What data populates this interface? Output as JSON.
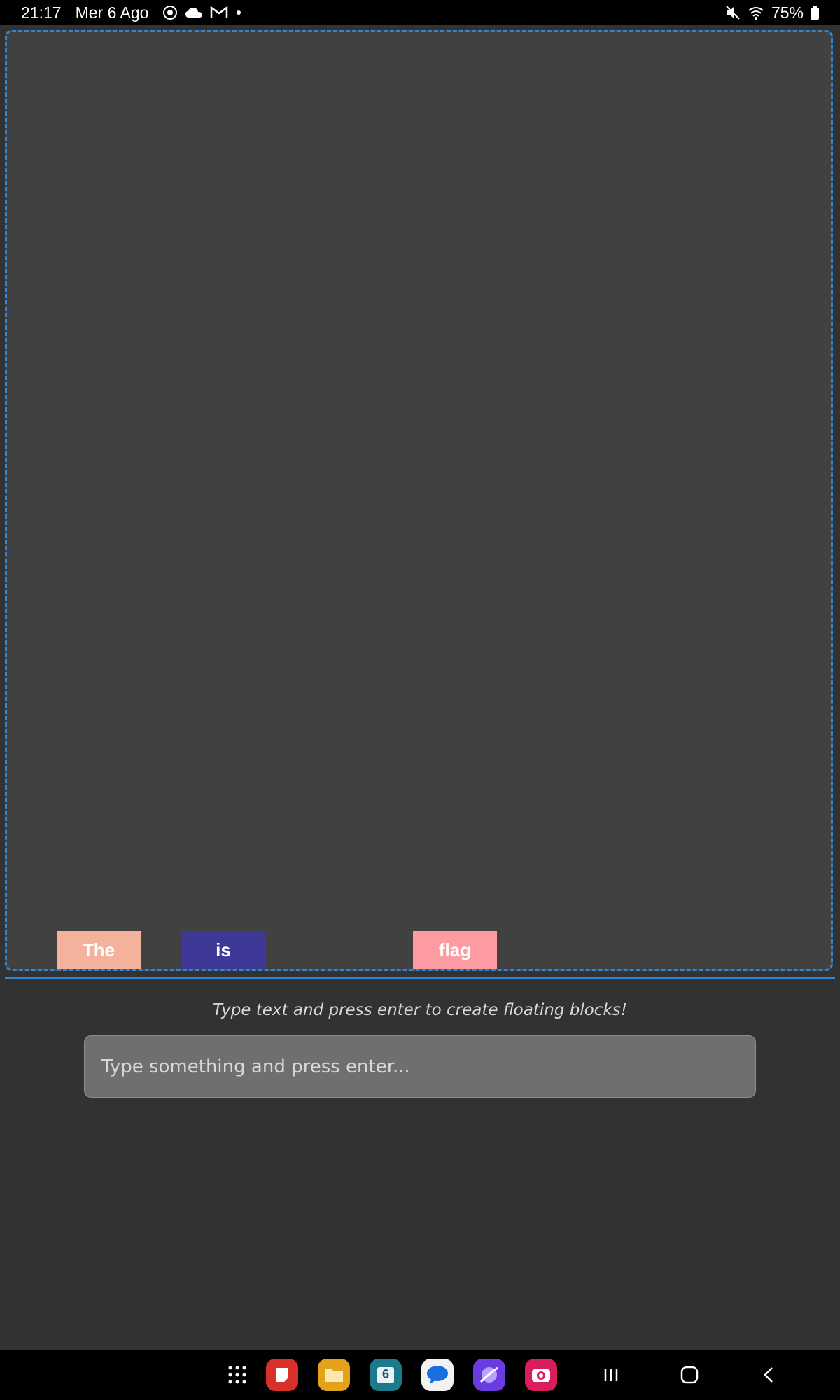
{
  "status_bar": {
    "time": "21:17",
    "date": "Mer 6 Ago",
    "battery": "75%",
    "left_icons": [
      "chrome-icon",
      "cloud-icon",
      "gmail-icon",
      "dot-icon"
    ],
    "right_icons": [
      "mute-icon",
      "wifi-icon",
      "battery-icon"
    ]
  },
  "blocks": [
    {
      "text": "The",
      "color": "#f4b19c"
    },
    {
      "text": "is",
      "color": "#3e3897"
    },
    {
      "text": "flag",
      "color": "#fd9ba2"
    }
  ],
  "hint": "Type text and press enter to create floating blocks!",
  "input": {
    "placeholder": "Type something and press enter...",
    "value": ""
  },
  "dock": {
    "apps": [
      {
        "name": "app-grid-icon",
        "color": "#000000"
      },
      {
        "name": "notes-app-icon",
        "color": "#d8302b"
      },
      {
        "name": "files-app-icon",
        "color": "#e3a21a"
      },
      {
        "name": "calendar-app-icon",
        "color": "#1b7a8c",
        "label": "6"
      },
      {
        "name": "messages-app-icon",
        "color": "#f2f2f2"
      },
      {
        "name": "internet-app-icon",
        "color": "#6a3be0"
      },
      {
        "name": "camera-app-icon",
        "color": "#d81e5b"
      }
    ],
    "nav": [
      "recents-icon",
      "home-icon",
      "back-icon"
    ]
  }
}
